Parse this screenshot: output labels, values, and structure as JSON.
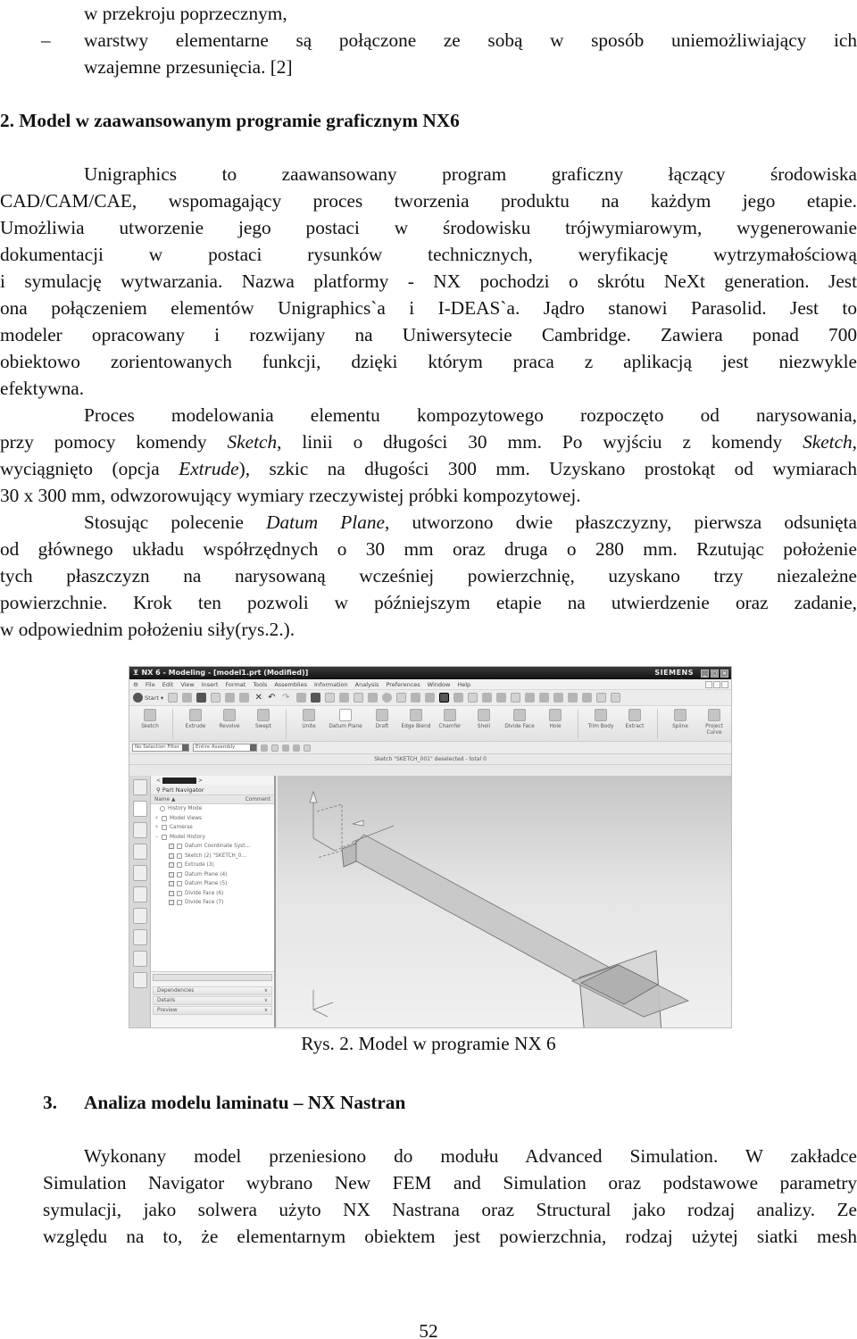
{
  "intro_list": {
    "continuation": "w przekroju poprzecznym,",
    "bullet_marker": "–",
    "bullet_line1": "warstwy elementarne są połączone ze sobą w sposób uniemożliwiający ich",
    "bullet_line2": "wzajemne przesunięcia. [2]"
  },
  "section2": {
    "heading": "2.  Model w zaawansowanym programie graficznym NX6",
    "paragraph1": [
      "Unigraphics to zaawansowany program graficzny łączący środowiska",
      "CAD/CAM/CAE, wspomagający proces tworzenia produktu na każdym jego etapie.",
      "Umożliwia utworzenie jego postaci w środowisku trójwymiarowym, wygenerowanie",
      "dokumentacji w postaci rysunków technicznych, weryfikację wytrzymałościową",
      "i symulację wytwarzania. Nazwa platformy - NX pochodzi o skrótu NeXt generation. Jest",
      "ona połączeniem elementów Unigraphics`a i I-DEAS`a. Jądro stanowi Parasolid. Jest to",
      "modeler opracowany i rozwijany na Uniwersytecie Cambridge. Zawiera ponad 700",
      "obiektowo zorientowanych funkcji, dzięki którym praca z aplikacją jest niezwykle",
      "efektywna."
    ],
    "paragraph2": {
      "l1": "Proces modelowania elementu kompozytowego rozpoczęto od narysowania,",
      "l2_a": "przy pomocy komendy ",
      "l2_b": "Sketch",
      "l2_c": ", linii o długości 30 mm. Po wyjściu z komendy ",
      "l2_d": "Sketch",
      "l2_e": ",",
      "l3_a": "wyciągnięto (opcja ",
      "l3_b": "Extrude",
      "l3_c": "), szkic na długości 300 mm. Uzyskano prostokąt od wymiarach",
      "l4": "30 x 300 mm, odwzorowujący wymiary rzeczywistej próbki kompozytowej."
    },
    "paragraph3": {
      "l1_a": "Stosując polecenie ",
      "l1_b": "Datum Plane",
      "l1_c": ", utworzono dwie płaszczyzny, pierwsza odsunięta",
      "l2": "od głównego układu współrzędnych o 30 mm oraz druga o 280 mm. Rzutując położenie",
      "l3": "tych płaszczyzn na narysowaną wcześniej powierzchnię, uzyskano trzy niezależne",
      "l4": "powierzchnie. Krok ten pozwoli w późniejszym etapie na utwierdzenie oraz zadanie,",
      "l5": "w odpowiednim położeniu siły(rys.2.)."
    }
  },
  "figure": {
    "window_title": "NX 6 - Modeling - [model1.prt (Modified)]",
    "brand": "SIEMENS",
    "window_buttons": [
      "_",
      "□",
      "×"
    ],
    "menu": [
      "File",
      "Edit",
      "View",
      "Insert",
      "Format",
      "Tools",
      "Assemblies",
      "Information",
      "Analysis",
      "Preferences",
      "Window",
      "Help"
    ],
    "start_label": "Start",
    "tools": [
      "Sketch",
      "Extrude",
      "Revolve",
      "Swept",
      "Unite",
      "Datum Plane",
      "Draft",
      "Edge Blend",
      "Chamfer",
      "Shell",
      "Divide Face",
      "Hole",
      "Trim Body",
      "Extract",
      "Spline",
      "Project Curve"
    ],
    "selection_filter": "No Selection Filter",
    "assembly_scope": "Entire Assembly",
    "status_message": "Sketch \"SKETCH_001\" deselected - total 0",
    "navigator": {
      "title": "Part Navigator",
      "col_name": "Name",
      "col_comment": "Comment",
      "items": [
        {
          "label": "History Mode",
          "level": 0
        },
        {
          "label": "Model Views",
          "level": 0
        },
        {
          "label": "Cameras",
          "level": 0
        },
        {
          "label": "Model History",
          "level": 0
        },
        {
          "label": "Datum Coordinate Syst...",
          "level": 1
        },
        {
          "label": "Sketch (2) \"SKETCH_0...",
          "level": 1
        },
        {
          "label": "Extrude (3)",
          "level": 1
        },
        {
          "label": "Datum Plane (4)",
          "level": 1
        },
        {
          "label": "Datum Plane (5)",
          "level": 1
        },
        {
          "label": "Divide Face (6)",
          "level": 1
        },
        {
          "label": "Divide Face (7)",
          "level": 1
        }
      ],
      "panels": [
        "Dependencies",
        "Details",
        "Preview"
      ]
    }
  },
  "caption": "Rys.  2. Model w programie NX 6",
  "section3": {
    "heading_num": "3.",
    "heading_text": "Analiza modelu laminatu – NX Nastran",
    "paragraph": [
      "Wykonany model przeniesiono do modułu Advanced Simulation. W zakładce",
      "Simulation Navigator wybrano New FEM and Simulation oraz podstawowe parametry",
      "symulacji, jako solwera użyto NX Nastrana oraz Structural jako rodzaj analizy. Ze",
      "względu na to, że elementarnym obiektem jest powierzchnia, rodzaj użytej siatki mesh"
    ]
  },
  "page_number": "52"
}
